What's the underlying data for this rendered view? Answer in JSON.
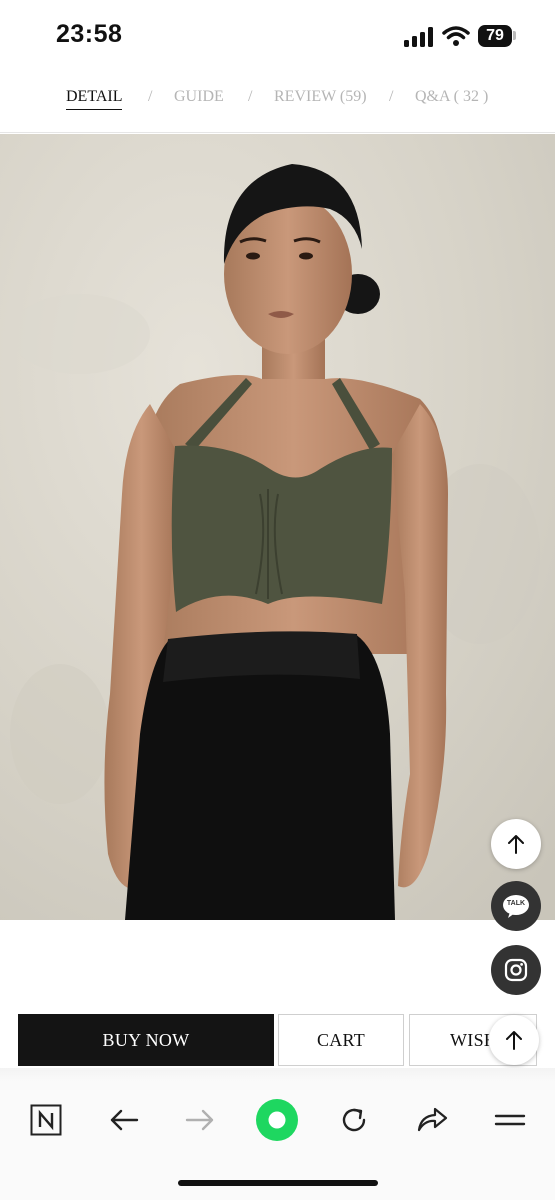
{
  "status": {
    "time": "23:58",
    "battery": "79"
  },
  "tabs": [
    {
      "label": "DETAIL",
      "active": true
    },
    {
      "label": "GUIDE",
      "active": false
    },
    {
      "label": "REVIEW (59)",
      "active": false
    },
    {
      "label": "Q&A ( 32 )",
      "active": false
    }
  ],
  "tab_separator": "/",
  "product_image": {
    "alt": "Olive green ruched halter crop top with black leggings"
  },
  "floating": {
    "talk_label": "TALK"
  },
  "actions": {
    "buy_now": "BUY NOW",
    "cart": "CART",
    "wish": "WISH"
  },
  "colors": {
    "accent_green": "#1ed760",
    "dark": "#141414",
    "top_olive": "#4f5440"
  }
}
